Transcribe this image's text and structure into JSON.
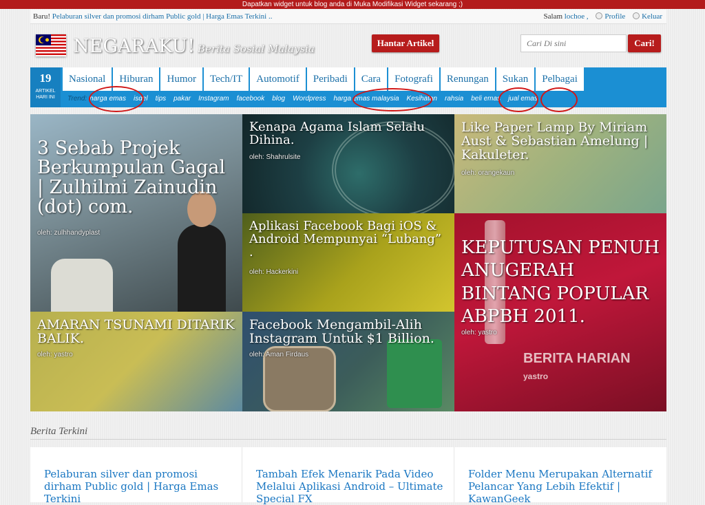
{
  "topbar": {
    "text": "Dapatkan widget untuk blog anda di Muka Modifikasi Widget sekarang ;)"
  },
  "infobar": {
    "prefix": "Baru!",
    "headline": "Pelaburan silver dan promosi dirham Public gold | Harga Emas Terkini ..",
    "greeting": "Salam",
    "username": "lochoe ,",
    "profile": "Profile",
    "logout": "Keluar"
  },
  "header": {
    "logo": "NEGARAKU!",
    "tagline": "Berita Sosial Malaysia",
    "submit_button": "Hantar Artikel",
    "search_placeholder": "Cari Di sini",
    "search_button": "Cari!"
  },
  "nav": {
    "count": "19",
    "count_label_1": "ARTIKEL",
    "count_label_2": "HARI INI",
    "tabs": [
      "Nasional",
      "Hiburan",
      "Humor",
      "Tech/IT",
      "Automotif",
      "Peribadi",
      "Cara",
      "Fotografi",
      "Renungan",
      "Sukan",
      "Pelbagai"
    ],
    "trend_label": "Trend:",
    "trends": [
      "harga emas",
      "isdel",
      "tips",
      "pakar",
      "Instagram",
      "facebook",
      "blog",
      "Wordpress",
      "harga emas malaysia",
      "Kesihatan",
      "rahsia",
      "beli emas",
      "jual emas"
    ]
  },
  "featured": [
    {
      "title": "3 Sebab Projek Berkumpulan Gagal | Zulhilmi Zainudin (dot) com.",
      "author": "oleh: zulhhandyplast"
    },
    {
      "title": "Kenapa Agama Islam Selalu Dihina.",
      "author": "oleh: Shahrulsite"
    },
    {
      "title": "Like Paper Lamp By Miriam Aust & Sebastian Amelung | Kakuleter.",
      "author": "oleh: orangekaun"
    },
    {
      "title": "Aplikasi Facebook Bagi iOS & Android Mempunyai “Lubang” .",
      "author": "oleh: Hackerkini"
    },
    {
      "title": "KEPUTUSAN PENUH ANUGERAH BINTANG POPULAR ABPBH 2011.",
      "author": "oleh: yastro",
      "image_text_1": "BERITA HARIAN",
      "image_text_2": "yastro"
    },
    {
      "title": "AMARAN TSUNAMI DITARIK BALIK.",
      "author": "oleh: yastro"
    },
    {
      "title": "Facebook Mengambil-Alih Instagram Untuk $1 Billion.",
      "author": "oleh: Aman Firdaus"
    }
  ],
  "latest": {
    "heading": "Berita Terkini",
    "items": [
      "Pelaburan silver dan promosi dirham Public gold | Harga Emas Terkini",
      "Tambah Efek Menarik Pada Video Melalui Aplikasi Android – Ultimate Special FX",
      "Folder Menu Merupakan Alternatif Pelancar Yang Lebih Efektif | KawanGeek"
    ]
  },
  "colors": {
    "accent_red": "#b71c1c",
    "nav_blue": "#1b8fd3",
    "link_blue": "#1a77c2",
    "annotation_red": "#d01616"
  }
}
